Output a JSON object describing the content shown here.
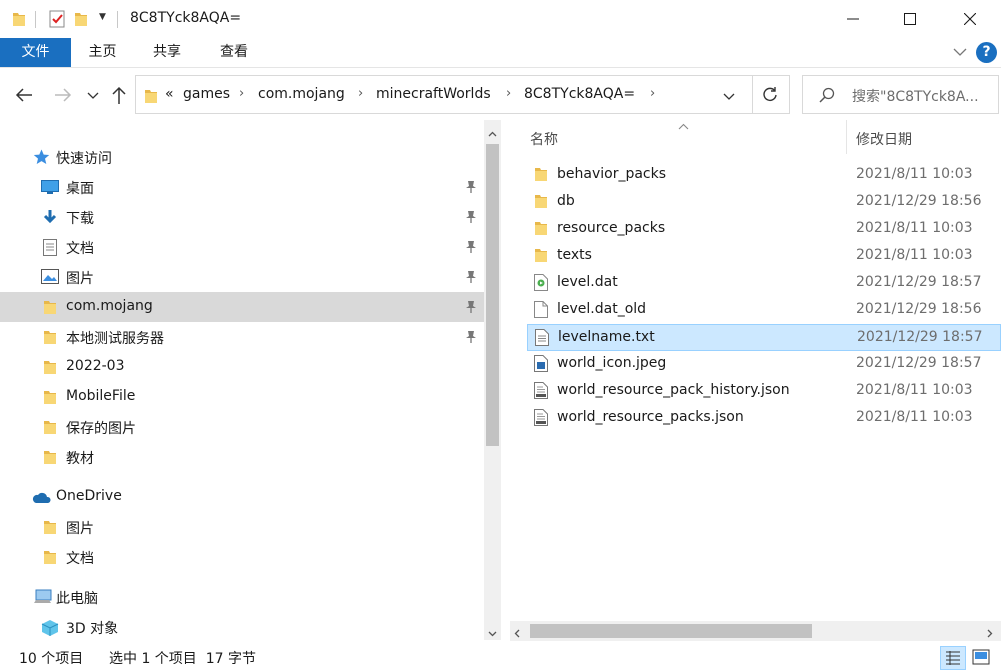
{
  "window": {
    "title": "8C8TYck8AQA="
  },
  "ribbon": {
    "tabs": [
      "文件",
      "主页",
      "共享",
      "查看"
    ]
  },
  "address": {
    "overflow": "«",
    "crumbs": [
      "games",
      "com.mojang",
      "minecraftWorlds",
      "8C8TYck8AQA="
    ]
  },
  "search": {
    "placeholder": "搜索\"8C8TYck8A..."
  },
  "nav": {
    "quick_access": "快速访问",
    "items": [
      {
        "label": "桌面",
        "icon": "desktop-icon"
      },
      {
        "label": "下载",
        "icon": "download-icon"
      },
      {
        "label": "文档",
        "icon": "document-icon"
      },
      {
        "label": "图片",
        "icon": "pictures-icon"
      },
      {
        "label": "com.mojang",
        "icon": "folder-icon"
      },
      {
        "label": "本地测试服务器",
        "icon": "folder-icon"
      },
      {
        "label": "2022-03",
        "icon": "folder-icon"
      },
      {
        "label": "MobileFile",
        "icon": "folder-icon"
      },
      {
        "label": "保存的图片",
        "icon": "folder-icon"
      },
      {
        "label": "教材",
        "icon": "folder-icon"
      }
    ],
    "onedrive": "OneDrive",
    "onedrive_items": [
      "图片",
      "文档"
    ],
    "this_pc": "此电脑",
    "objects_3d": "3D 对象"
  },
  "content": {
    "col_name": "名称",
    "col_date": "修改日期",
    "files": [
      {
        "name": "behavior_packs",
        "date": "2021/8/11 10:03",
        "icon": "folder-icon"
      },
      {
        "name": "db",
        "date": "2021/12/29 18:56",
        "icon": "folder-icon"
      },
      {
        "name": "resource_packs",
        "date": "2021/8/11 10:03",
        "icon": "folder-icon"
      },
      {
        "name": "texts",
        "date": "2021/8/11 10:03",
        "icon": "folder-icon"
      },
      {
        "name": "level.dat",
        "date": "2021/12/29 18:57",
        "icon": "dat-file-icon"
      },
      {
        "name": "level.dat_old",
        "date": "2021/12/29 18:56",
        "icon": "blank-file-icon"
      },
      {
        "name": "levelname.txt",
        "date": "2021/12/29 18:57",
        "icon": "text-file-icon"
      },
      {
        "name": "world_icon.jpeg",
        "date": "2021/12/29 18:57",
        "icon": "image-file-icon"
      },
      {
        "name": "world_resource_pack_history.json",
        "date": "2021/8/11 10:03",
        "icon": "json-file-icon"
      },
      {
        "name": "world_resource_packs.json",
        "date": "2021/8/11 10:03",
        "icon": "json-file-icon"
      }
    ]
  },
  "status": {
    "count": "10 个项目",
    "selection": "选中 1 个项目  17 字节"
  },
  "colors": {
    "accent": "#1a6fc0",
    "selection": "#cce8ff",
    "folder": "#f8d775"
  }
}
